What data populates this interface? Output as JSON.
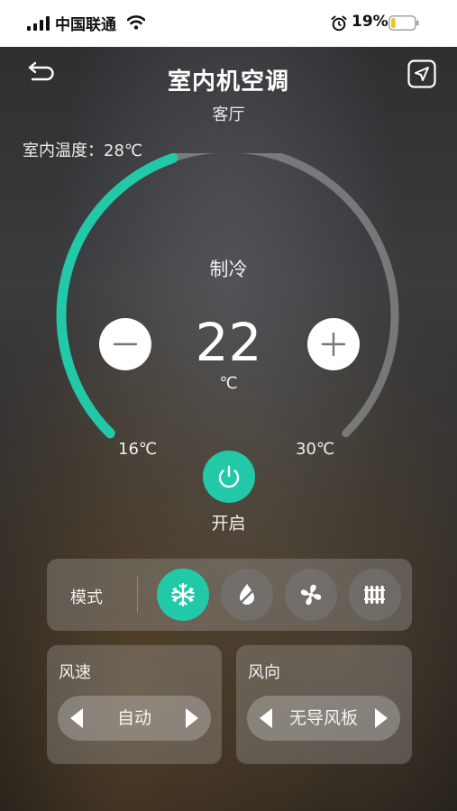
{
  "status_bar": {
    "carrier": "中国联通",
    "battery_percent": "19%",
    "battery_level": 0.19,
    "icons": [
      "signal-icon",
      "wifi-icon",
      "alarm-icon",
      "battery-icon"
    ]
  },
  "header": {
    "title": "室内机空调",
    "subtitle": "客厅",
    "icons": [
      "back-icon",
      "share-icon"
    ]
  },
  "indoor_temperature": "室内温度：28℃",
  "thermostat": {
    "mode": "制冷",
    "setpoint": "22",
    "unit": "℃",
    "min_label": "16℃",
    "max_label": "30℃",
    "min": 16,
    "max": 30,
    "value": 22,
    "accent_color": "#22c9a9",
    "track_color": "#8a8c8e"
  },
  "power": {
    "label": "开启",
    "icon": "power-icon",
    "color": "#22c9a9"
  },
  "mode_panel": {
    "label": "模式",
    "options": [
      {
        "icon": "snowflake-icon",
        "active": true
      },
      {
        "icon": "drop-icon",
        "active": false
      },
      {
        "icon": "fan-icon",
        "active": false
      },
      {
        "icon": "heater-icon",
        "active": false
      }
    ]
  },
  "fan_speed": {
    "title": "风速",
    "value": "自动"
  },
  "wind_direction": {
    "title": "风向",
    "value": "无导风板"
  }
}
